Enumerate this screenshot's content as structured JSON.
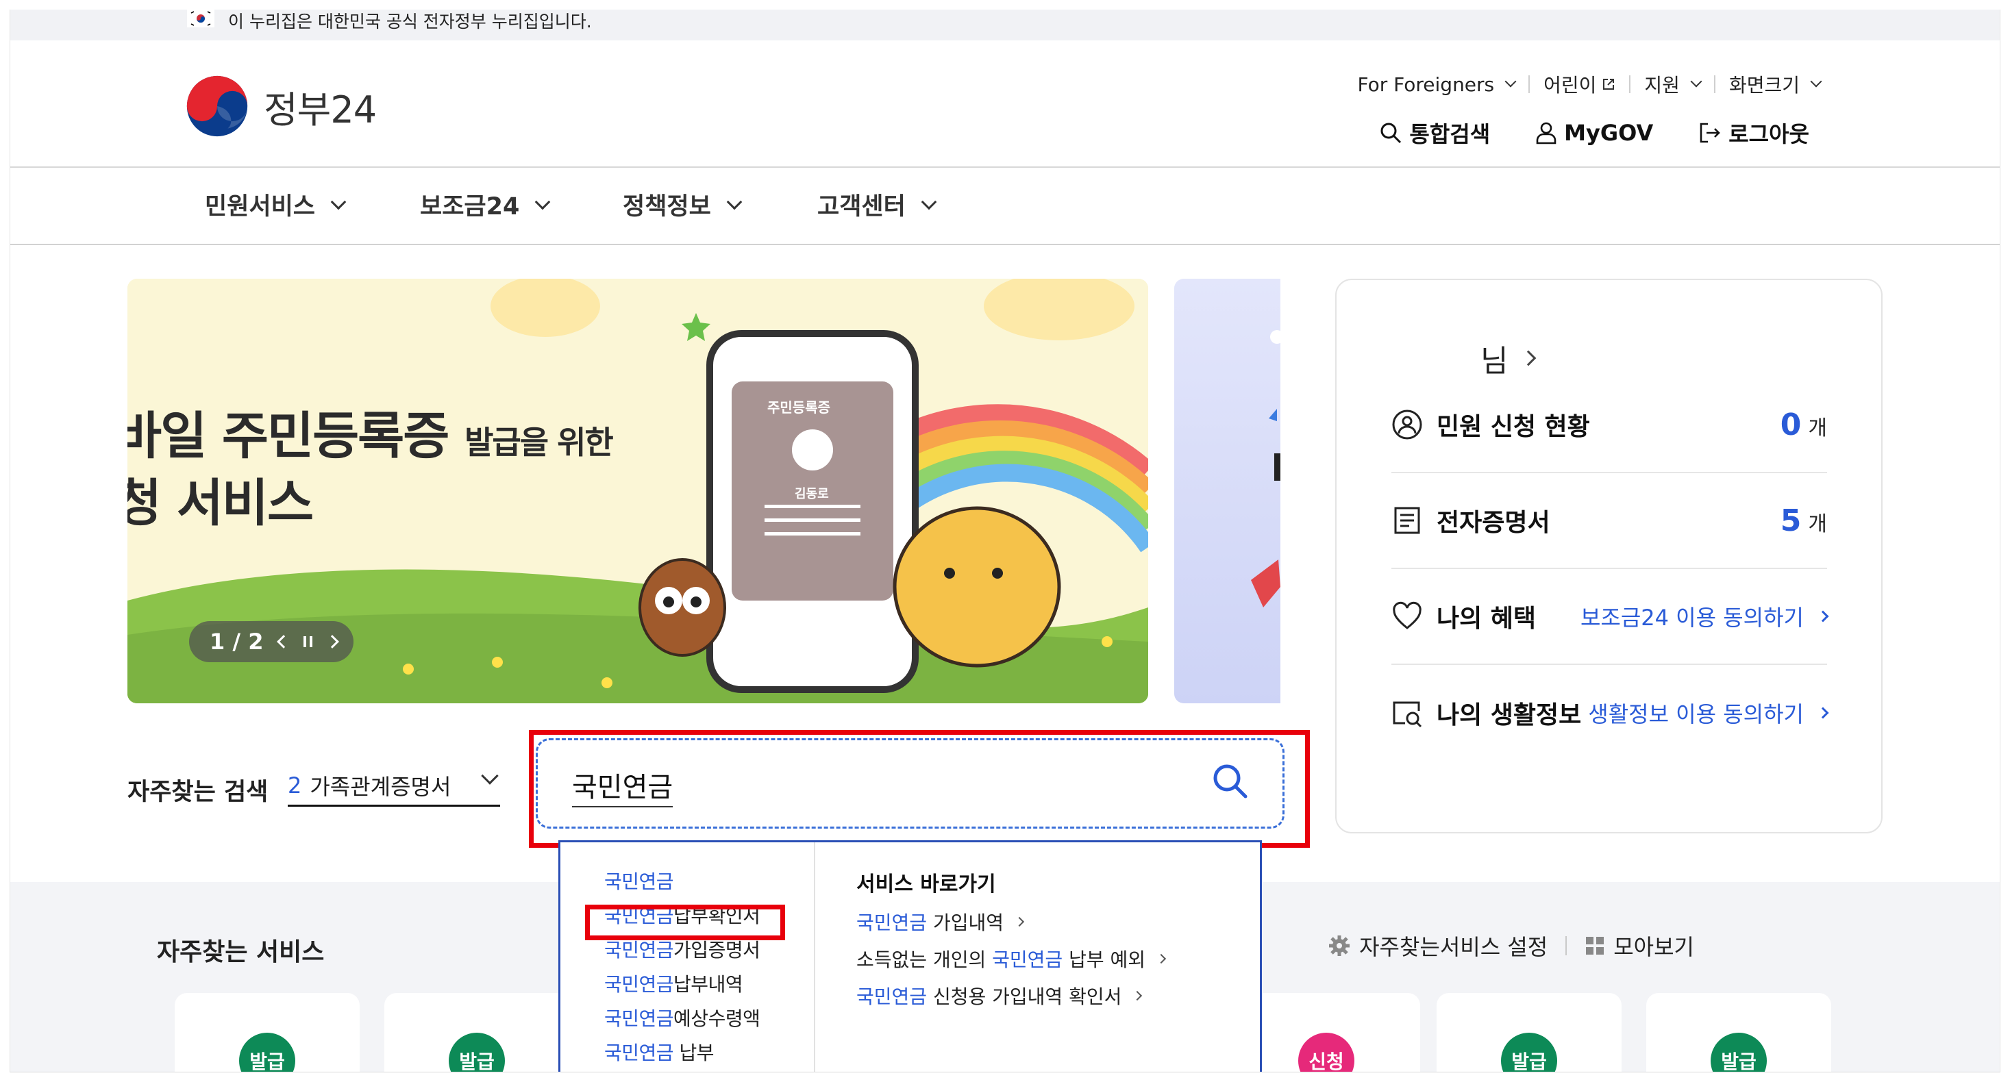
{
  "notice": {
    "text": "이 누리집은 대한민국 공식 전자정부 누리집입니다."
  },
  "logo": {
    "text": "정부24"
  },
  "util_nav": [
    {
      "label": "For Foreigners",
      "icon": "chevron-down-icon"
    },
    {
      "label": "어린이",
      "icon": "external-link-icon"
    },
    {
      "label": "지원",
      "icon": "chevron-down-icon"
    },
    {
      "label": "화면크기",
      "icon": "chevron-down-icon"
    }
  ],
  "actions": [
    {
      "label": "통합검색",
      "icon": "search-icon"
    },
    {
      "label": "MyGOV",
      "icon": "person-icon"
    },
    {
      "label": "로그아웃",
      "icon": "logout-icon"
    }
  ],
  "gnb": [
    "민원서비스",
    "보조금24",
    "정책정보",
    "고객센터"
  ],
  "slide": {
    "title_line1": "바일 주민등록증",
    "title_line1_sub": "발급을 위한",
    "title_line2": "청 서비스",
    "card_title": "주민등록증",
    "card_name": "김동로",
    "pager": "1 / 2"
  },
  "panel": {
    "greeting": "님",
    "rows": [
      {
        "label": "민원 신청 현황",
        "count": "0",
        "unit": "개"
      },
      {
        "label": "전자증명서",
        "count": "5",
        "unit": "개"
      },
      {
        "label": "나의 혜택",
        "link": "보조금24 이용 동의하기"
      },
      {
        "label": "나의 생활정보",
        "link": "생활정보 이용 동의하기"
      }
    ]
  },
  "frequent_search": {
    "label": "자주찾는 검색",
    "rank": "2",
    "term": "가족관계증명서"
  },
  "search": {
    "value": "국민연금"
  },
  "autocomplete": {
    "highlight": "국민연금",
    "suggestions": [
      {
        "hl": "국민연금",
        "rest": ""
      },
      {
        "hl": "국민연금",
        "rest": "납부확인서"
      },
      {
        "hl": "국민연금",
        "rest": "가입증명서"
      },
      {
        "hl": "국민연금",
        "rest": "납부내역"
      },
      {
        "hl": "국민연금",
        "rest": "예상수령액"
      },
      {
        "hl": "국민연금",
        "rest": " 납부"
      }
    ],
    "shortcut_title": "서비스 바로가기",
    "shortcuts": [
      {
        "pre": "",
        "hl": "국민연금",
        "post": " 가입내역"
      },
      {
        "pre": "소득없는 개인의 ",
        "hl": "국민연금",
        "post": " 납부 예외"
      },
      {
        "pre": "",
        "hl": "국민연금",
        "post": " 신청용 가입내역 확인서"
      }
    ]
  },
  "frequent_services": {
    "title": "자주찾는 서비스",
    "settings_label": "자주찾는서비스 설정",
    "viewall_label": "모아보기",
    "badges": [
      {
        "label": "발급",
        "color": "#0d8a57"
      },
      {
        "label": "발급",
        "color": "#0d8a57"
      },
      {
        "label": "신청",
        "color": "#e6297a"
      },
      {
        "label": "발급",
        "color": "#0d8a57"
      },
      {
        "label": "발급",
        "color": "#0d8a57"
      }
    ]
  },
  "colors": {
    "accent": "#2a5bd7",
    "highlight_box": "#e8000b",
    "badge_green": "#0d8a57",
    "badge_pink": "#e6297a"
  }
}
